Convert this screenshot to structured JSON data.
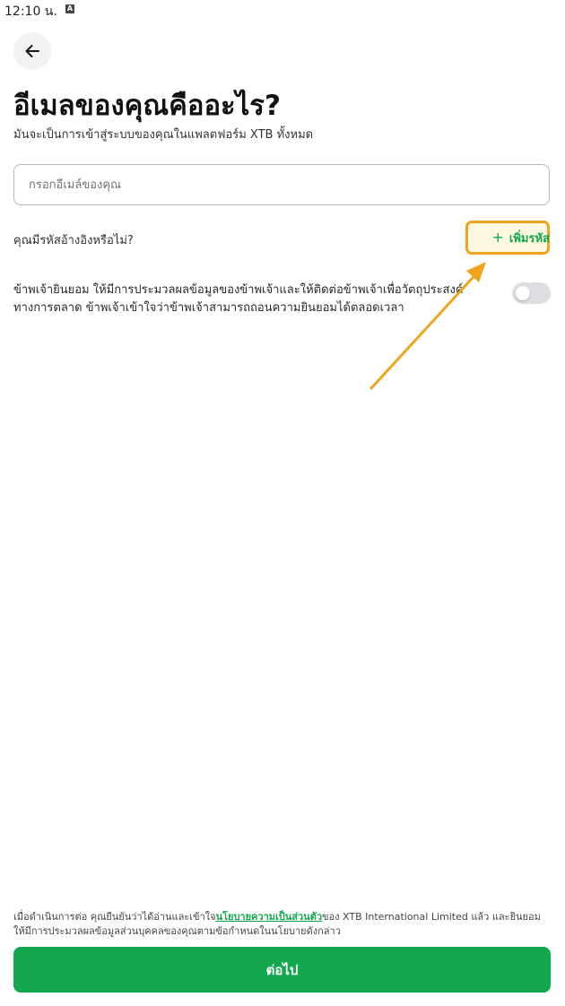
{
  "status_bar": {
    "time": "12:10 น.",
    "notification_icon": "a-box-icon",
    "notification_glyph": "A"
  },
  "header": {
    "back_icon": "arrow-left-icon",
    "title": "อีเมลของคุณคืออะไร?",
    "subtitle": "มันจะเป็นการเข้าสู่ระบบของคุณในแพลตฟอร์ม XTB ทั้งหมด"
  },
  "email_field": {
    "placeholder": "กรอกอีเมล์ของคุณ",
    "value": ""
  },
  "referral": {
    "question": "คุณมีรหัสอ้างอิงหรือไม่?",
    "add_icon": "+",
    "add_label": "เพิ่มรหัส"
  },
  "consent": {
    "text": "ข้าพเจ้ายินยอม ให้มีการประมวลผลข้อมูลของข้าพเจ้าและให้ติดต่อข้าพเจ้าเพื่อวัตถุประสงค์ทางการตลาด ข้าพเจ้าเข้าใจว่าข้าพเจ้าสามารถถอนความยินยอมได้ตลอดเวลา",
    "toggle_on": false
  },
  "footer": {
    "legal_prefix": "เมื่อดำเนินการต่อ คุณยืนยันว่าได้อ่านและเข้าใจ",
    "privacy_link": "นโยบายความเป็นส่วนตัว",
    "legal_suffix": "ของ XTB International Limited แล้ว และยินยอมให้มีการประมวลผลข้อมูลส่วนบุคคลของคุณตามข้อกำหนดในนโยบายดังกล่าว",
    "next_label": "ต่อไป"
  },
  "colors": {
    "accent_green": "#13a84d",
    "annotation_orange": "#f0a41e",
    "toggle_off": "#dcdee1"
  }
}
